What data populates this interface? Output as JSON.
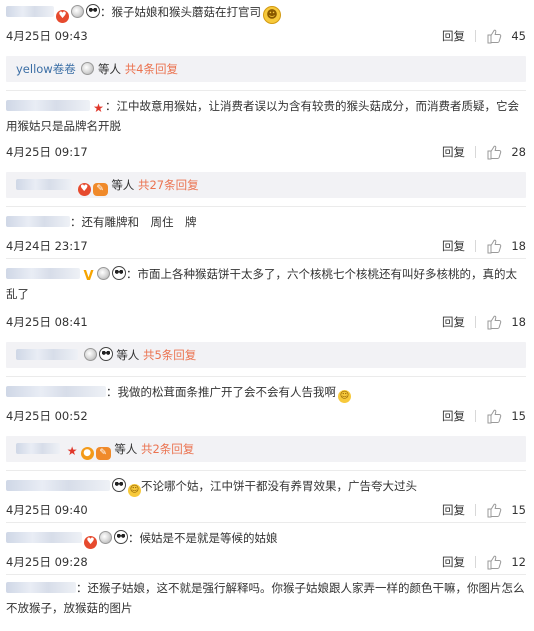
{
  "comments": [
    {
      "text": "：猴子姑娘和猴头蘑菇在打官司",
      "date": "4月25日 09:43",
      "reply_label": "回复",
      "likes": "45"
    },
    {
      "text": "：江中故意用猴姑，让消费者误以为含有较贵的猴头菇成分，而消费者质疑，它会用猴姑只是品牌名开脱",
      "date": "4月25日 09:17",
      "reply_label": "回复",
      "likes": "28"
    },
    {
      "text": "：还有雕牌和　周住　牌",
      "date": "4月24日 23:17",
      "reply_label": "回复",
      "likes": "18"
    },
    {
      "text": "：市面上各种猴菇饼干太多了，六个核桃七个核桃还有叫好多核桃的，真的太乱了",
      "date": "4月25日 08:41",
      "reply_label": "回复",
      "likes": "18"
    },
    {
      "text": "：我做的松茸面条推广开了会不会有人告我啊",
      "date": "4月25日 00:52",
      "reply_label": "回复",
      "likes": "15"
    },
    {
      "text": "不论哪个姑，江中饼干都没有养胃效果，广告夸大过头",
      "date": "4月25日 09:40",
      "reply_label": "回复",
      "likes": "15"
    },
    {
      "text": "：候姑是不是就是等候的姑娘",
      "date": "4月25日 09:28",
      "reply_label": "回复",
      "likes": "12"
    },
    {
      "text": "：还猴子姑娘，这不就是强行解释吗。你猴子姑娘跟人家弄一样的颜色干嘛，你图片怎么不放猴子，放猴菇的图片"
    }
  ],
  "subreplies": [
    {
      "name": "yellow卷卷",
      "mid": "等人",
      "link": "共4条回复"
    },
    {
      "mid": "等人",
      "link": "共27条回复"
    },
    {
      "mid": "等人",
      "link": "共5条回复"
    },
    {
      "mid": "等人",
      "link": "共2条回复"
    }
  ]
}
